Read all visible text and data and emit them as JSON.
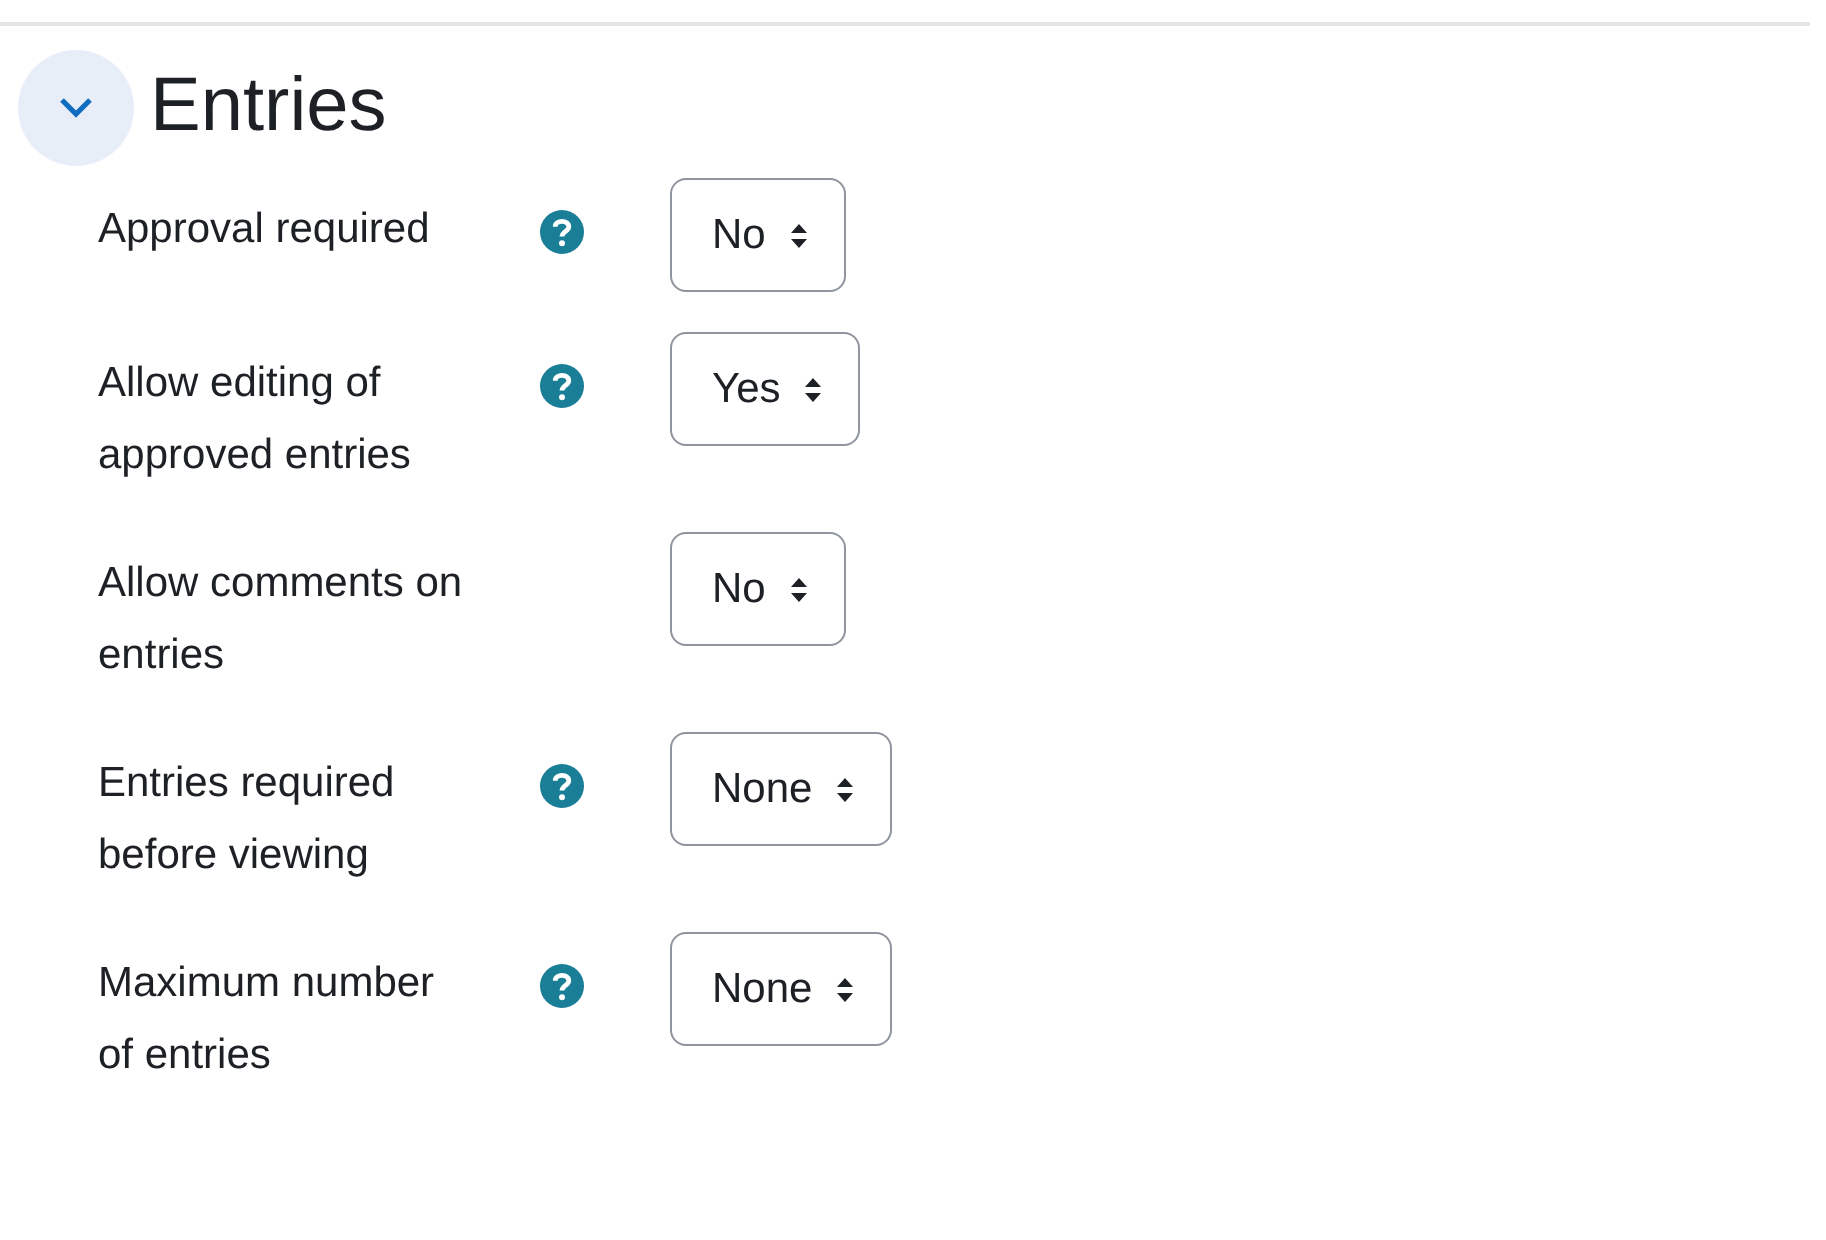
{
  "section": {
    "title": "Entries",
    "expanded": true
  },
  "fields": [
    {
      "label": "Approval required",
      "help": true,
      "value": "No"
    },
    {
      "label": "Allow editing of approved entries",
      "help": true,
      "value": "Yes"
    },
    {
      "label": "Allow comments on entries",
      "help": false,
      "value": "No"
    },
    {
      "label": "Entries required before viewing",
      "help": true,
      "value": "None"
    },
    {
      "label": "Maximum number of entries",
      "help": true,
      "value": "None"
    }
  ]
}
